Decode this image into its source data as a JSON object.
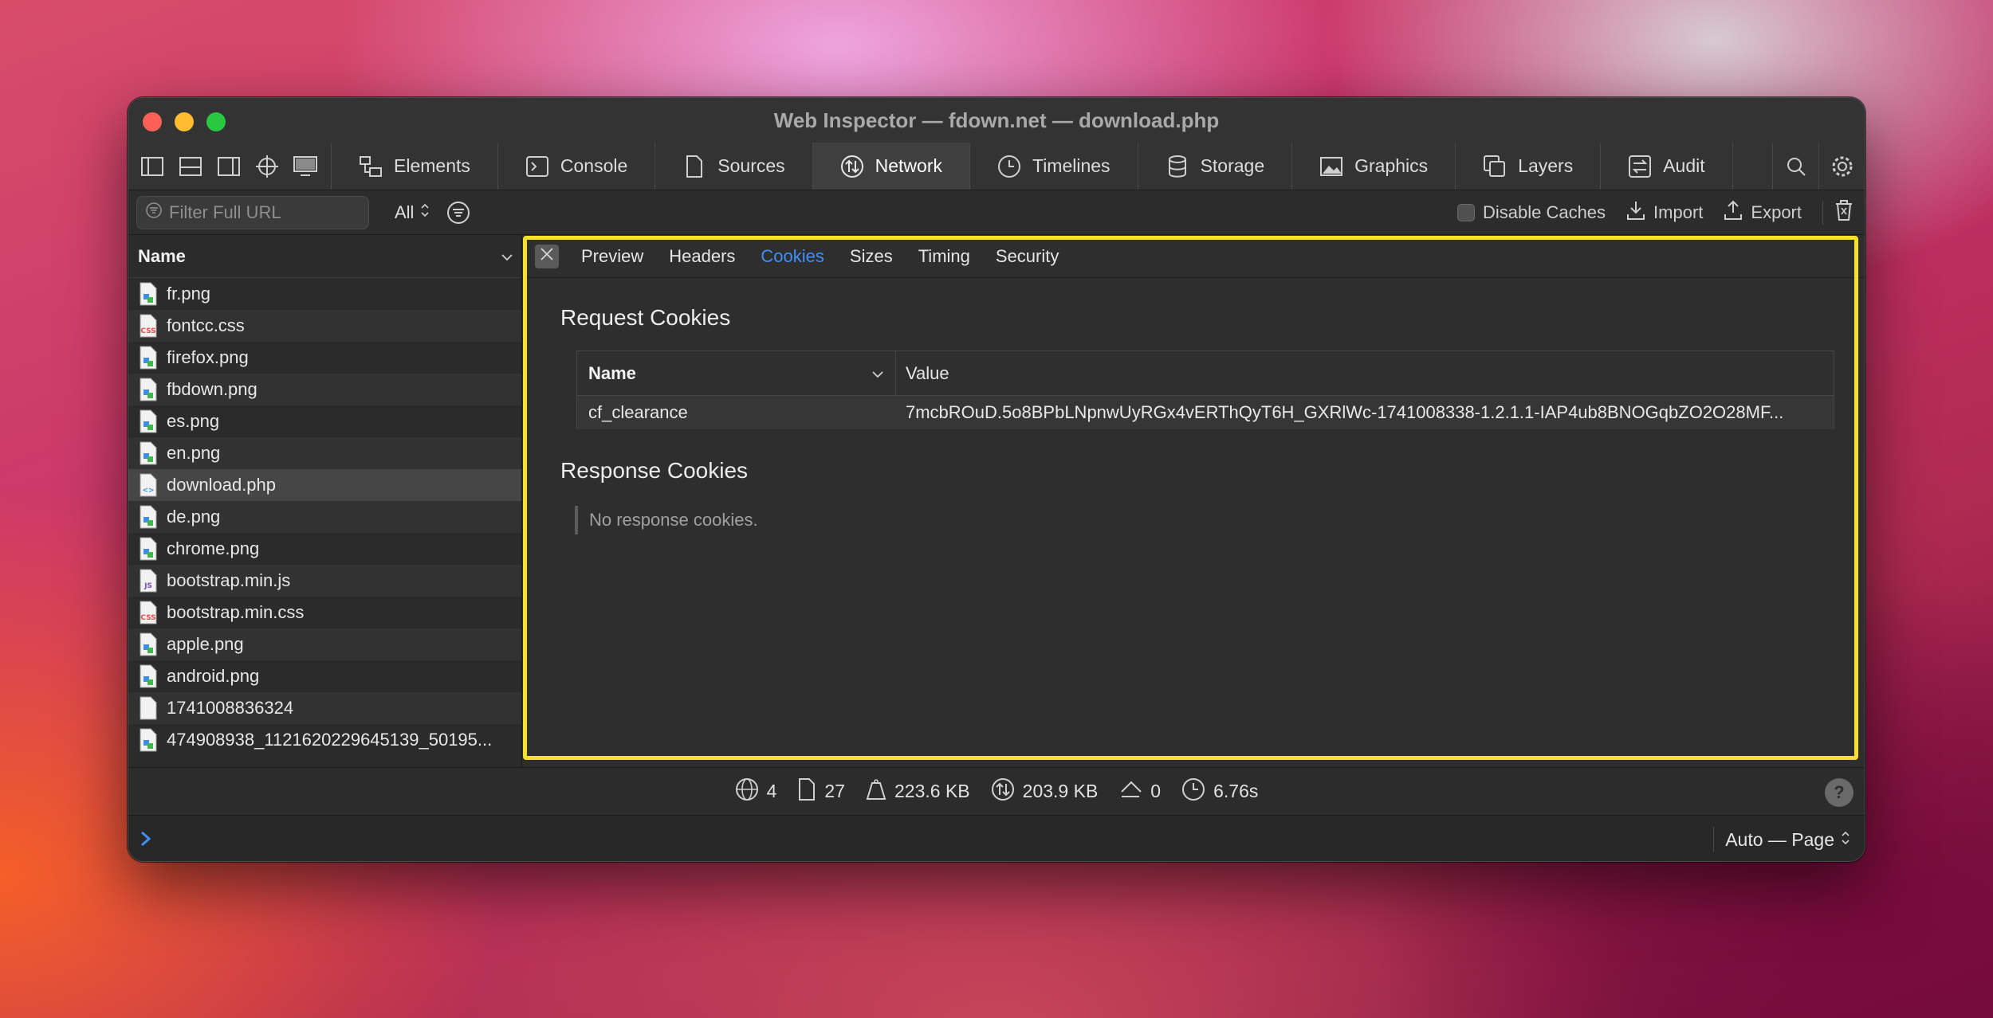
{
  "window": {
    "title": "Web Inspector — fdown.net — download.php"
  },
  "tabs": [
    {
      "label": "Elements",
      "icon": "elements-icon"
    },
    {
      "label": "Console",
      "icon": "console-icon"
    },
    {
      "label": "Sources",
      "icon": "sources-icon"
    },
    {
      "label": "Network",
      "icon": "network-icon",
      "active": true
    },
    {
      "label": "Timelines",
      "icon": "timelines-icon"
    },
    {
      "label": "Storage",
      "icon": "storage-icon"
    },
    {
      "label": "Graphics",
      "icon": "graphics-icon"
    },
    {
      "label": "Layers",
      "icon": "layers-icon"
    },
    {
      "label": "Audit",
      "icon": "audit-icon"
    }
  ],
  "filter": {
    "placeholder": "Filter Full URL",
    "type_select": "All",
    "disable_caches": "Disable Caches",
    "import": "Import",
    "export": "Export"
  },
  "sidebar": {
    "header": "Name",
    "files": [
      {
        "name": "fr.png",
        "type": "image"
      },
      {
        "name": "fontcc.css",
        "type": "css"
      },
      {
        "name": "firefox.png",
        "type": "image"
      },
      {
        "name": "fbdown.png",
        "type": "image"
      },
      {
        "name": "es.png",
        "type": "image"
      },
      {
        "name": "en.png",
        "type": "image"
      },
      {
        "name": "download.php",
        "type": "document",
        "selected": true
      },
      {
        "name": "de.png",
        "type": "image"
      },
      {
        "name": "chrome.png",
        "type": "image"
      },
      {
        "name": "bootstrap.min.js",
        "type": "js"
      },
      {
        "name": "bootstrap.min.css",
        "type": "css"
      },
      {
        "name": "apple.png",
        "type": "image"
      },
      {
        "name": "android.png",
        "type": "image"
      },
      {
        "name": "1741008836324",
        "type": "other"
      },
      {
        "name": "474908938_1121620229645139_50195...",
        "type": "image"
      }
    ]
  },
  "detail": {
    "tabs": [
      "Preview",
      "Headers",
      "Cookies",
      "Sizes",
      "Timing",
      "Security"
    ],
    "active_tab": "Cookies",
    "request_title": "Request Cookies",
    "table": {
      "col_name": "Name",
      "col_value": "Value",
      "rows": [
        {
          "name": "cf_clearance",
          "value": "7mcbROuD.5o8BPbLNpnwUyRGx4vERThQyT6H_GXRlWc-1741008338-1.2.1.1-IAP4ub8BNOGqbZO2O28MF..."
        }
      ]
    },
    "response_title": "Response Cookies",
    "no_response": "No response cookies."
  },
  "status": {
    "domains": "4",
    "resources": "27",
    "transferred": "223.6 KB",
    "size": "203.9 KB",
    "redirects": "0",
    "time": "6.76s",
    "help": "?"
  },
  "console": {
    "context": "Auto — Page"
  },
  "colors": {
    "accent": "#3f8ff7",
    "highlight": "#f7e02a"
  }
}
